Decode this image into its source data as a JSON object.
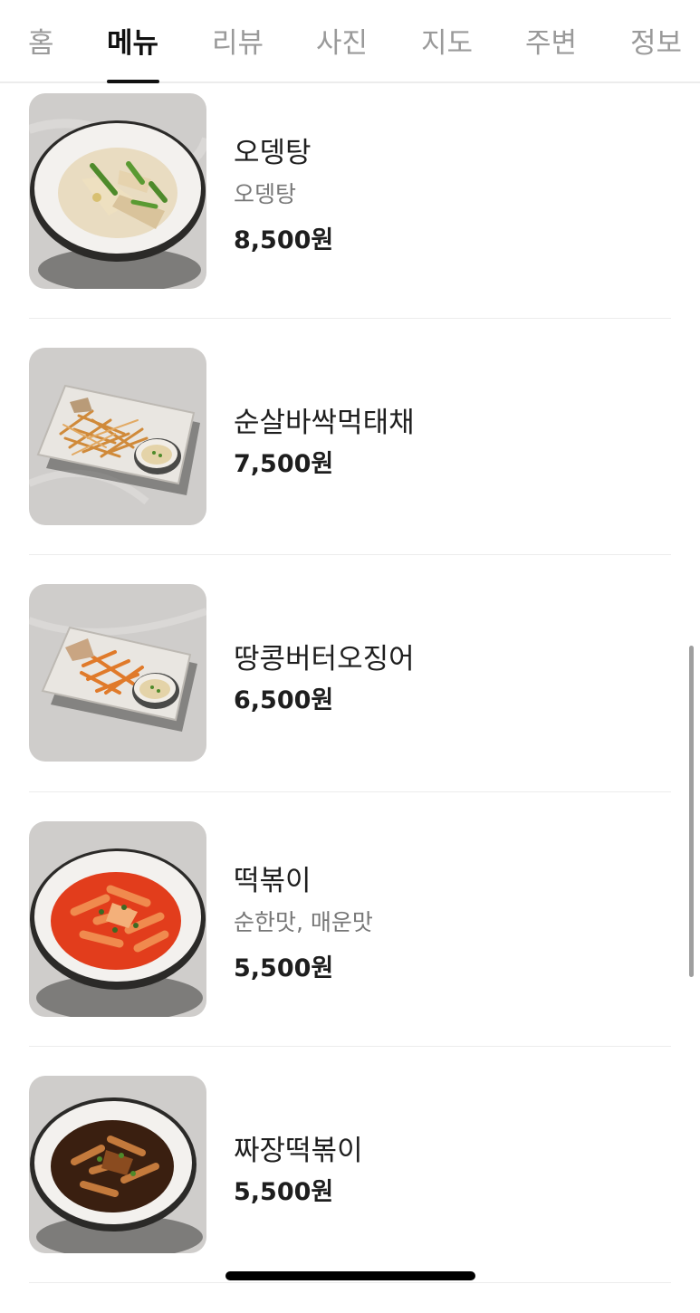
{
  "tabs": [
    {
      "label": "홈",
      "active": false
    },
    {
      "label": "메뉴",
      "active": true
    },
    {
      "label": "리뷰",
      "active": false
    },
    {
      "label": "사진",
      "active": false
    },
    {
      "label": "지도",
      "active": false
    },
    {
      "label": "주변",
      "active": false
    },
    {
      "label": "정보",
      "active": false
    }
  ],
  "menu": {
    "items": [
      {
        "name": "오뎅탕",
        "desc": "오뎅탕",
        "price": "8,500원",
        "image": "fishcake-soup-bowl"
      },
      {
        "name": "순살바싹먹태채",
        "desc": "",
        "price": "7,500원",
        "image": "dried-pollock-plate"
      },
      {
        "name": "땅콩버터오징어",
        "desc": "",
        "price": "6,500원",
        "image": "peanut-butter-squid-plate"
      },
      {
        "name": "떡볶이",
        "desc": "순한맛, 매운맛",
        "price": "5,500원",
        "image": "tteokbokki-bowl"
      },
      {
        "name": "짜장떡볶이",
        "desc": "",
        "price": "5,500원",
        "image": "jjajang-tteokbokki-bowl"
      }
    ]
  },
  "colors": {
    "active_tab": "#111111",
    "inactive_tab": "#9a9a9a",
    "secondary_text": "#777777",
    "divider": "#ececec"
  }
}
